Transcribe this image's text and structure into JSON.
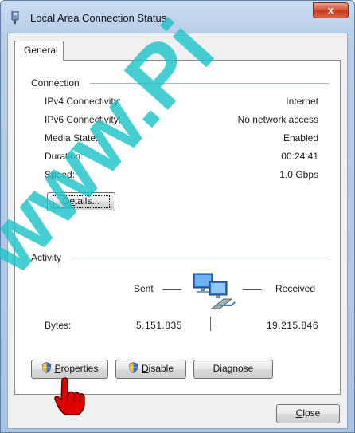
{
  "window": {
    "title": "Local Area Connection Status",
    "close_label": "x"
  },
  "tabs": [
    {
      "label": "General"
    }
  ],
  "connection": {
    "group_label": "Connection",
    "rows": [
      {
        "label": "IPv4 Connectivity:",
        "value": "Internet"
      },
      {
        "label": "IPv6 Connectivity:",
        "value": "No network access"
      },
      {
        "label": "Media State:",
        "value": "Enabled"
      },
      {
        "label": "Duration:",
        "value": "00:24:41"
      },
      {
        "label": "Speed:",
        "value": "1.0 Gbps"
      }
    ],
    "details_button": {
      "prefix": "D",
      "mnemonic": "e",
      "suffix": "tails..."
    }
  },
  "activity": {
    "group_label": "Activity",
    "sent_label": "Sent",
    "received_label": "Received",
    "bytes_label": "Bytes:",
    "bytes_sent": "5.151.835",
    "bytes_received": "19.215.846"
  },
  "buttons": {
    "properties": {
      "mnemonic": "P",
      "rest": "roperties"
    },
    "disable": {
      "mnemonic": "D",
      "rest": "isable"
    },
    "diagnose": {
      "prefix": "Dia",
      "mnemonic": "g",
      "suffix": "nose"
    },
    "close": {
      "mnemonic": "C",
      "rest": "lose"
    }
  },
  "watermark": {
    "text": "www.Pi"
  },
  "colors": {
    "accent": "#1ec3c8",
    "close_red": "#c9442a",
    "cursor_red": "#e00000"
  }
}
